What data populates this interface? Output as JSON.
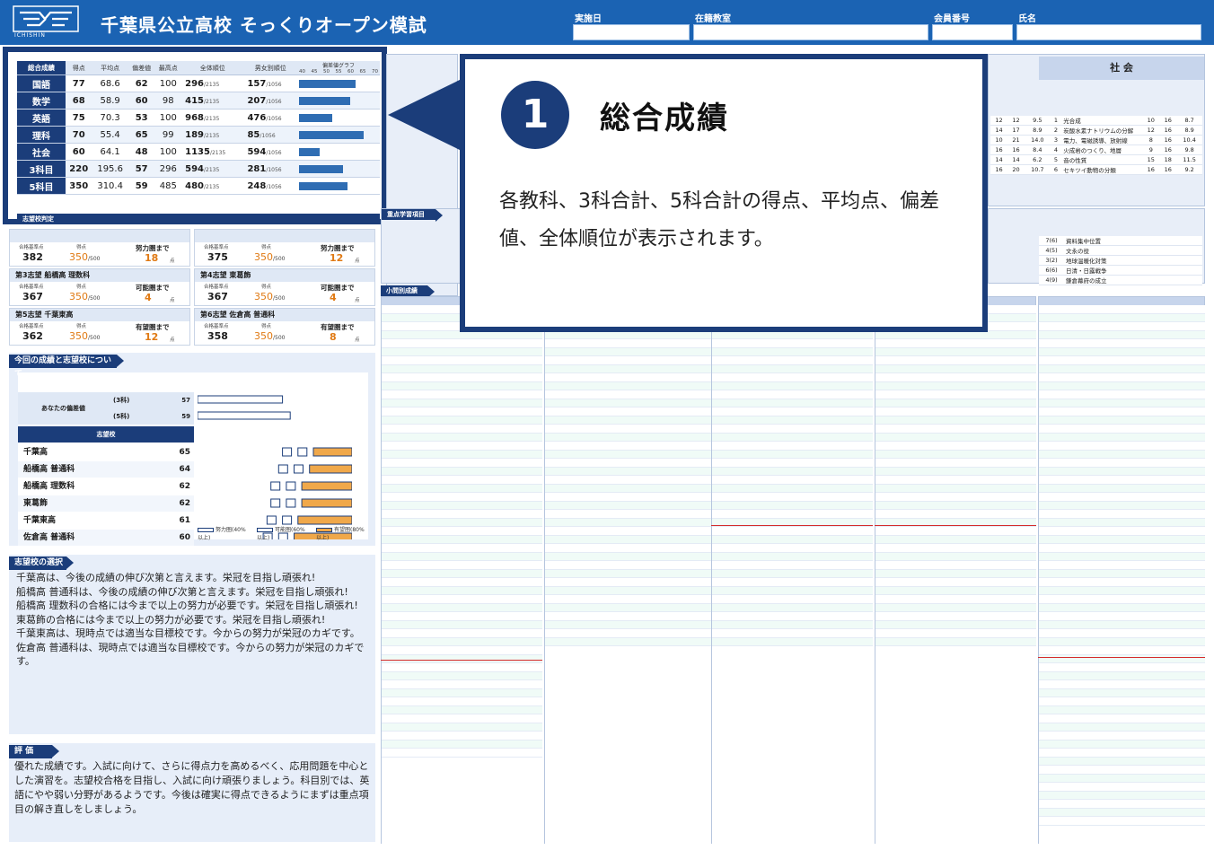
{
  "header": {
    "logo_text": "ICHISHIN",
    "title": "千葉県公立高校 そっくりオープン模試",
    "fields": [
      {
        "label": "実施日"
      },
      {
        "label": "在籍教室"
      },
      {
        "label": "会員番号"
      },
      {
        "label": "氏名"
      }
    ]
  },
  "score_table": {
    "section_label": "総合成績",
    "headers": [
      "得点",
      "平均点",
      "偏差値",
      "最高点",
      "全体順位",
      "男女別順位",
      "偏差値グラフ"
    ],
    "scale": [
      "40",
      "45",
      "50",
      "55",
      "60",
      "65",
      "70"
    ],
    "rows": [
      {
        "subject": "国語",
        "score": "77",
        "avg": "68.6",
        "dev": "62",
        "max": "100",
        "rank": "296",
        "rank_total": "/2135",
        "gender_rank": "157",
        "gender_total": "/1056",
        "dev_value": 62
      },
      {
        "subject": "数学",
        "score": "68",
        "avg": "58.9",
        "dev": "60",
        "max": "98",
        "rank": "415",
        "rank_total": "/2135",
        "gender_rank": "207",
        "gender_total": "/1056",
        "dev_value": 60
      },
      {
        "subject": "英語",
        "score": "75",
        "avg": "70.3",
        "dev": "53",
        "max": "100",
        "rank": "968",
        "rank_total": "/2135",
        "gender_rank": "476",
        "gender_total": "/1056",
        "dev_value": 53
      },
      {
        "subject": "理科",
        "score": "70",
        "avg": "55.4",
        "dev": "65",
        "max": "99",
        "rank": "189",
        "rank_total": "/2135",
        "gender_rank": "85",
        "gender_total": "/1056",
        "dev_value": 65
      },
      {
        "subject": "社会",
        "score": "60",
        "avg": "64.1",
        "dev": "48",
        "max": "100",
        "rank": "1135",
        "rank_total": "/2135",
        "gender_rank": "594",
        "gender_total": "/1056",
        "dev_value": 48
      },
      {
        "subject": "3科目",
        "score": "220",
        "avg": "195.6",
        "dev": "57",
        "max": "296",
        "rank": "594",
        "rank_total": "/2135",
        "gender_rank": "281",
        "gender_total": "/1056",
        "dev_value": 57
      },
      {
        "subject": "5科目",
        "score": "350",
        "avg": "310.4",
        "dev": "59",
        "max": "485",
        "rank": "480",
        "rank_total": "/2135",
        "gender_rank": "248",
        "gender_total": "/1056",
        "dev_value": 59
      }
    ],
    "bottom_label": "志望校判定"
  },
  "callout": {
    "number": "1",
    "title": "総合成績",
    "description": "各教科、3科合計、5科合計の得点、平均点、偏差値、全体順位が表示されます。"
  },
  "aspirations": [
    {
      "head": "",
      "std_label": "合格基準点",
      "std": "382",
      "score_label": "得点",
      "score": "350",
      "score_max": "/500",
      "status": "努力圏まで",
      "gap": "18",
      "unit": "点"
    },
    {
      "head": "",
      "std_label": "合格基準点",
      "std": "375",
      "score_label": "得点",
      "score": "350",
      "score_max": "/500",
      "status": "努力圏まで",
      "gap": "12",
      "unit": "点"
    },
    {
      "head": "第3志望 船橋高 理数科",
      "std_label": "合格基準点",
      "std": "367",
      "score_label": "得点",
      "score": "350",
      "score_max": "/500",
      "status": "可能圏まで",
      "gap": "4",
      "unit": "点"
    },
    {
      "head": "第4志望 東葛飾",
      "std_label": "合格基準点",
      "std": "367",
      "score_label": "得点",
      "score": "350",
      "score_max": "/500",
      "status": "可能圏まで",
      "gap": "4",
      "unit": "点"
    },
    {
      "head": "第5志望 千葉東高",
      "std_label": "合格基準点",
      "std": "362",
      "score_label": "得点",
      "score": "350",
      "score_max": "/500",
      "status": "有望圏まで",
      "gap": "12",
      "unit": "点"
    },
    {
      "head": "第6志望 佐倉高 普通科",
      "std_label": "合格基準点",
      "std": "358",
      "score_label": "得点",
      "score": "350",
      "score_max": "/500",
      "status": "有望圏まで",
      "gap": "8",
      "unit": "点"
    }
  ],
  "comparison": {
    "section_label": "今回の成績と志望校について",
    "self_label": "あなたの偏差値",
    "self_rows": [
      {
        "label": "(3科)",
        "value": "57"
      },
      {
        "label": "(5科)",
        "value": "59"
      }
    ],
    "schools_label": "志望校",
    "schools": [
      {
        "name": "千葉高",
        "value": "65"
      },
      {
        "name": "船橋高 普通科",
        "value": "64"
      },
      {
        "name": "船橋高 理数科",
        "value": "62"
      },
      {
        "name": "東葛飾",
        "value": "62"
      },
      {
        "name": "千葉東高",
        "value": "61"
      },
      {
        "name": "佐倉高 普通科",
        "value": "60"
      }
    ],
    "legend": [
      "努力圏(40%以上)",
      "可能圏(60%以上)",
      "有望圏(80%以上)"
    ]
  },
  "selection": {
    "section_label": "志望校の選択",
    "lines": [
      "千葉高は、今後の成績の伸び次第と言えます。栄冠を目指し頑張れ!",
      "船橋高 普通科は、今後の成績の伸び次第と言えます。栄冠を目指し頑張れ!",
      "船橋高 理数科の合格には今まで以上の努力が必要です。栄冠を目指し頑張れ!",
      "東葛飾の合格には今まで以上の努力が必要です。栄冠を目指し頑張れ!",
      "千葉東高は、現時点では適当な目標校です。今からの努力が栄冠のカギです。",
      "佐倉高 普通科は、現時点では適当な目標校です。今からの努力が栄冠のカギです。"
    ]
  },
  "evaluation": {
    "section_label": "評 価",
    "text": "優れた成績です。入試に向けて、さらに得点力を高めるべく、応用問題を中心とした演習を。志望校合格を目指し、入試に向け頑張りましょう。科目別では、英語にやや弱い分野があるようです。今後は確実に得点できるようにまずは重点項目の解き直しをしましょう。"
  },
  "right": {
    "social_head": "社 会",
    "priority_label": "重点学習項目",
    "detail_label": "小問別成績",
    "social_items": [
      {
        "a": "12",
        "b": "12",
        "c": "9.5",
        "no": "1",
        "name": "光合成",
        "p": "10",
        "q": "16",
        "r": "8.7"
      },
      {
        "a": "14",
        "b": "17",
        "c": "8.9",
        "no": "2",
        "name": "炭酸水素ナトリウムの分解",
        "p": "12",
        "q": "16",
        "r": "8.9"
      },
      {
        "a": "10",
        "b": "21",
        "c": "14.0",
        "no": "3",
        "name": "電力、電磁誘導、放射線",
        "p": "8",
        "q": "16",
        "r": "10.4"
      },
      {
        "a": "16",
        "b": "16",
        "c": "8.4",
        "no": "4",
        "name": "火成岩のつくり、地層",
        "p": "9",
        "q": "16",
        "r": "9.8"
      },
      {
        "a": "14",
        "b": "14",
        "c": "6.2",
        "no": "5",
        "name": "音の性質",
        "p": "15",
        "q": "18",
        "r": "11.5"
      },
      {
        "a": "16",
        "b": "20",
        "c": "10.7",
        "no": "6",
        "name": "セキツイ動物の分類",
        "p": "16",
        "q": "16",
        "r": "9.2"
      }
    ],
    "priority_items": [
      {
        "no": "7(6)",
        "name": "資料集中位置"
      },
      {
        "no": "4(5)",
        "name": "文永の役"
      },
      {
        "no": "3(2)",
        "name": "地球温暖化対策"
      },
      {
        "no": "6(6)",
        "name": "日清・日露戦争"
      },
      {
        "no": "4(9)",
        "name": "鎌倉幕府の成立"
      }
    ]
  }
}
